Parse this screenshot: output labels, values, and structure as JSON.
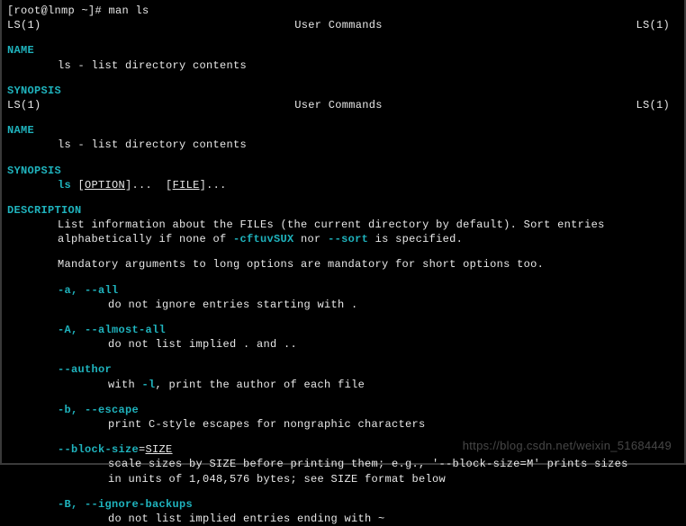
{
  "prompt": "[root@lnmp ~]# man ls",
  "hdr": {
    "left": "LS(1)",
    "center": "User Commands",
    "right": "LS(1)"
  },
  "sec": {
    "name": "NAME",
    "synopsis": "SYNOPSIS",
    "description": "DESCRIPTION"
  },
  "name_line": "ls - list directory contents",
  "syn": {
    "cmd": "ls",
    "opt": "OPTION",
    "dots1": "]...  [",
    "file": "FILE",
    "dots2": "]..."
  },
  "desc1a": "List  information  about the FILEs (the current directory by default).  Sort entries",
  "desc1b_pre": "alphabetically if none of ",
  "desc1b_flag1": "-cftuvSUX",
  "desc1b_mid": " nor ",
  "desc1b_flag2": "--sort",
  "desc1b_post": " is specified.",
  "desc2": "Mandatory arguments to long options are mandatory for short options too.",
  "opts": {
    "a": {
      "flag": "-a, --all",
      "text": "do not ignore entries starting with ."
    },
    "A": {
      "flag": "-A, --almost-all",
      "text": "do not list implied . and .."
    },
    "author": {
      "flag": "--author",
      "pre": "with ",
      "mid": "-l",
      "post": ", print the author of each file"
    },
    "b": {
      "flag": "-b, --escape",
      "text": "print C-style escapes for nongraphic characters"
    },
    "block": {
      "flag_pre": "--block-size",
      "flag_eq": "=",
      "flag_arg": "SIZE",
      "t1": "scale  sizes  by  SIZE before printing them; e.g., '--block-size=M' prints sizes",
      "t2": "in units of 1,048,576 bytes; see SIZE format below"
    },
    "B": {
      "flag": "-B, --ignore-backups",
      "text": "do not list implied entries ending with ~"
    }
  },
  "watermark": "https://blog.csdn.net/weixin_51684449"
}
